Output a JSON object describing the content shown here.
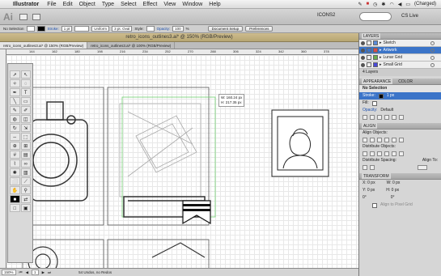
{
  "menubar": {
    "apple": "",
    "app_name": "Illustrator",
    "items": [
      "File",
      "Edit",
      "Object",
      "Type",
      "Select",
      "Effect",
      "View",
      "Window",
      "Help"
    ],
    "battery": "(Charged)"
  },
  "workspace": {
    "logo": "Ai",
    "name": "ICONS2",
    "cs_live": "CS Live"
  },
  "control": {
    "selection": "No Selection",
    "stroke_label": "Stroke:",
    "stroke_value": "1 pt",
    "uniform": "Uniform",
    "brush": "3 pt. Oval",
    "style_label": "Style:",
    "opacity_label": "Opacity:",
    "opacity_value": "100",
    "percent": "%",
    "doc_setup": "Document Setup",
    "preferences": "Preferences"
  },
  "document": {
    "title": "retro_icons_outlines3.ai* @ 150% (RGB/Preview)",
    "tabs": [
      "retro_icons_outlines3.ai* @ 150% (RGB/Preview)",
      "retro_icons_outlines3.ai* @ 100% (RGB/Preview)"
    ]
  },
  "ruler": {
    "labels": [
      "144",
      "162",
      "180",
      "198",
      "216",
      "234",
      "252",
      "270",
      "288",
      "306",
      "324",
      "342",
      "360",
      "378"
    ]
  },
  "canvas": {
    "measure_w": "W: 160.24 px",
    "measure_h": "H: 217.35 px"
  },
  "status": {
    "zoom": "150%",
    "page": "1",
    "undo": "54 Undos, no Redos"
  },
  "layers_panel": {
    "title": "LAYERS",
    "layers": [
      {
        "name": "Sketch",
        "color": "#5a8bd8",
        "selected": false
      },
      {
        "name": "Artwork",
        "color": "#d84a4a",
        "selected": true
      },
      {
        "name": "Lunar Grid",
        "color": "#6ab04c",
        "selected": false
      },
      {
        "name": "Small Grid",
        "color": "#4a4ad8",
        "selected": false
      }
    ],
    "count": "4 Layers"
  },
  "appearance_panel": {
    "tab1": "APPEARANCE",
    "tab2": "COLOR",
    "selection": "No Selection",
    "stroke_label": "Stroke:",
    "stroke_value": "1 px",
    "fill_label": "Fill:",
    "opacity_label": "Opacity:",
    "opacity_value": "Default"
  },
  "align_panel": {
    "title": "ALIGN",
    "align_objects": "Align Objects:",
    "distribute_objects": "Distribute Objects:",
    "distribute_spacing": "Distribute Spacing:",
    "align_to": "Align To:"
  },
  "transform_panel": {
    "title": "TRANSFORM",
    "x": "X: 0 px",
    "y": "Y: 0 px",
    "w": "W: 0 px",
    "h": "H: 0 px",
    "angle": "0°",
    "shear": "0°",
    "align_pixel": "Align to Pixel Grid"
  }
}
